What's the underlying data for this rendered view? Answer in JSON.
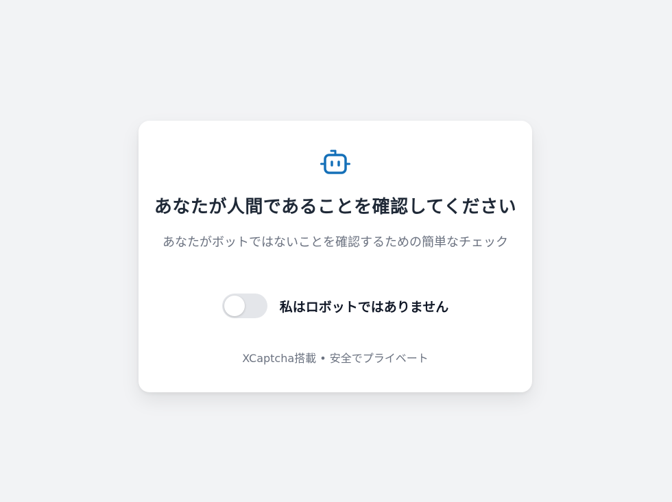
{
  "captcha": {
    "logo_icon": "robot-icon",
    "accent_color": "#1570b8",
    "title": "あなたが人間であることを確認してください",
    "subtitle": "あなたがボットではないことを確認するための簡単なチェック",
    "toggle_label": "私はロボットではありません",
    "toggle_on": false,
    "footer": "XCaptcha搭載 • 安全でプライベート"
  }
}
